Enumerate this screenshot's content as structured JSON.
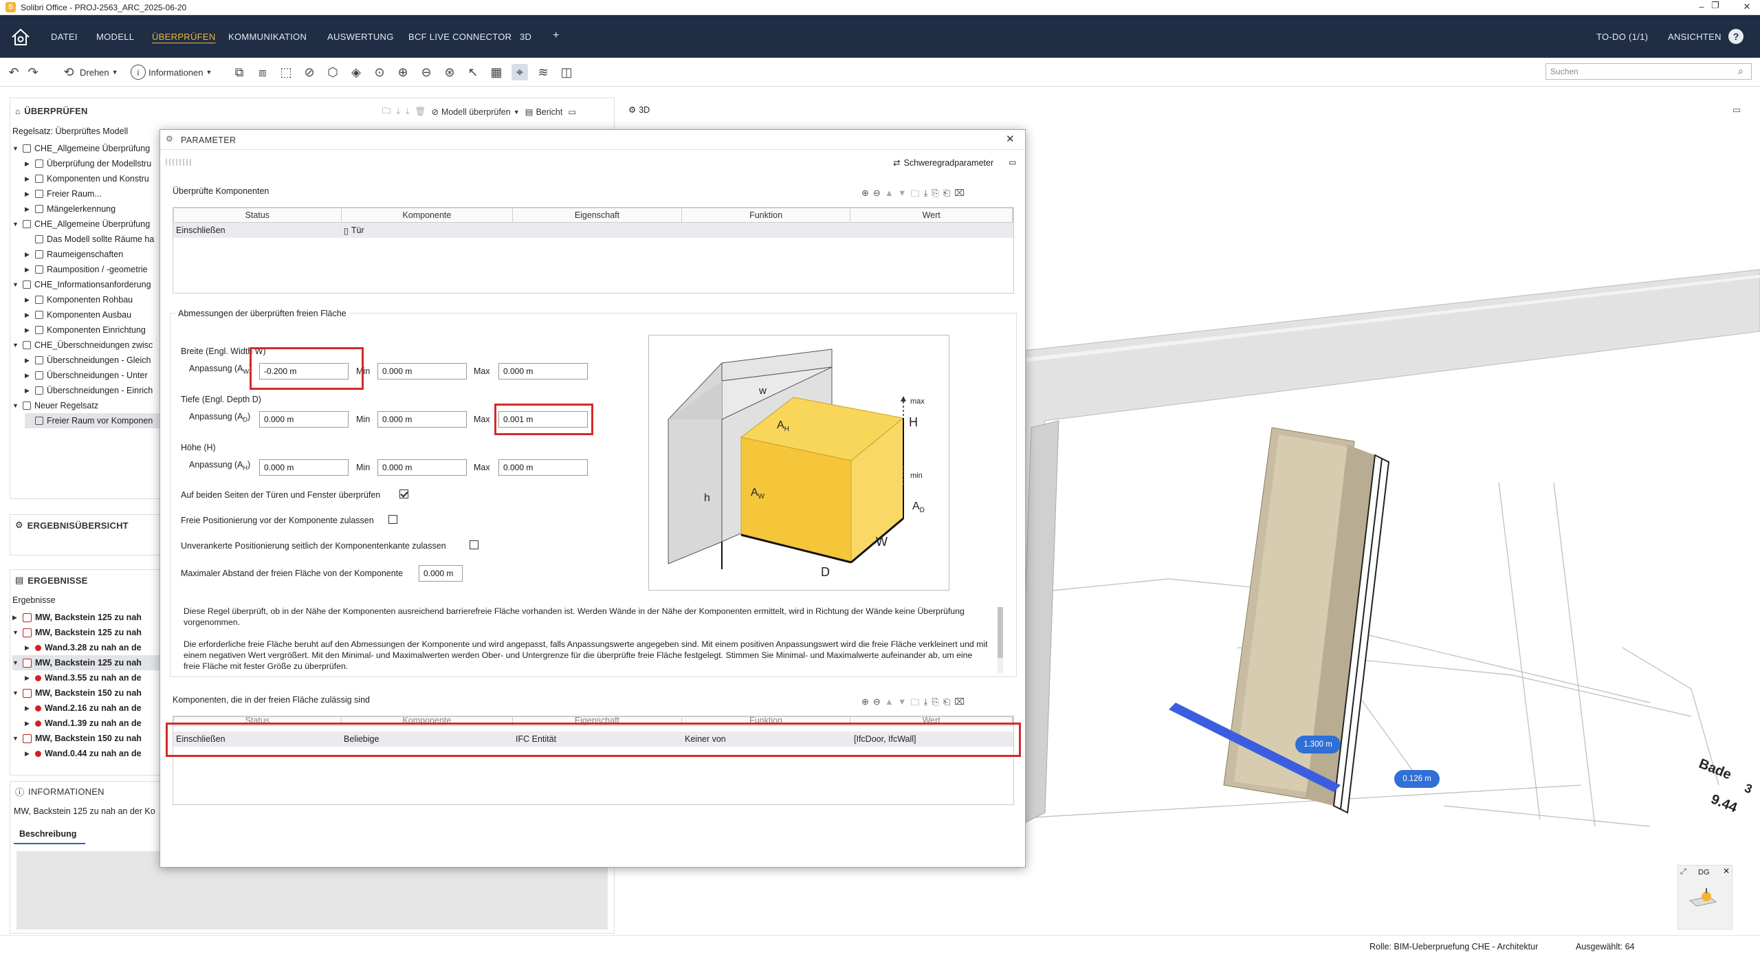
{
  "window": {
    "title": "Solibri Office - PROJ-2563_ARC_2025-06-20",
    "app_icon": "S"
  },
  "menu": {
    "items": [
      "DATEI",
      "MODELL",
      "ÜBERPRÜFEN",
      "KOMMUNIKATION",
      "AUSWERTUNG",
      "BCF LIVE CONNECTOR",
      "3D"
    ],
    "active": "ÜBERPRÜFEN",
    "add": "+",
    "todo": "TO-DO (1/1)",
    "views": "ANSICHTEN",
    "help": "?"
  },
  "toolbar": {
    "rotate": "Drehen",
    "info": "Informationen",
    "search_placeholder": "Suchen"
  },
  "left": {
    "check_header": "ÜBERPRÜFEN",
    "check_model_btn": "Modell überprüfen",
    "report_btn": "Bericht",
    "ruleset_label": "Regelsatz: Überprüftes Modell",
    "tree": [
      {
        "lvl": 0,
        "t": "CHE_Allgemeine Überprüfung",
        "tw": "▼"
      },
      {
        "lvl": 1,
        "t": "Überprüfung der Modellstru",
        "tw": "▶"
      },
      {
        "lvl": 1,
        "t": "Komponenten und Konstru",
        "tw": "▶"
      },
      {
        "lvl": 1,
        "t": "Freier Raum...",
        "tw": "▶"
      },
      {
        "lvl": 1,
        "t": "Mängelerkennung",
        "tw": "▶"
      },
      {
        "lvl": 0,
        "t": "CHE_Allgemeine Überprüfung",
        "tw": "▼"
      },
      {
        "lvl": 1,
        "t": "Das Modell sollte Räume ha",
        "tw": ""
      },
      {
        "lvl": 1,
        "t": "Raumeigenschaften",
        "tw": "▶"
      },
      {
        "lvl": 1,
        "t": "Raumposition / -geometrie",
        "tw": "▶"
      },
      {
        "lvl": 0,
        "t": "CHE_Informationsanforderung",
        "tw": "▼"
      },
      {
        "lvl": 1,
        "t": "Komponenten Rohbau",
        "tw": "▶"
      },
      {
        "lvl": 1,
        "t": "Komponenten Ausbau",
        "tw": "▶"
      },
      {
        "lvl": 1,
        "t": "Komponenten Einrichtung",
        "tw": "▶"
      },
      {
        "lvl": 0,
        "t": "CHE_Überschneidungen zwisc",
        "tw": "▼"
      },
      {
        "lvl": 1,
        "t": "Überschneidungen - Gleich",
        "tw": "▶"
      },
      {
        "lvl": 1,
        "t": "Überschneidungen - Unter",
        "tw": "▶"
      },
      {
        "lvl": 1,
        "t": "Überschneidungen - Einrich",
        "tw": "▶"
      },
      {
        "lvl": 0,
        "t": "Neuer Regelsatz",
        "tw": "▼"
      },
      {
        "lvl": 1,
        "t": "Freier Raum vor Komponen",
        "tw": "",
        "sel": true
      }
    ],
    "summary_header": "ERGEBNISÜBERSICHT",
    "results_header": "ERGEBNISSE",
    "results_label": "Ergebnisse",
    "results": [
      {
        "lvl": 0,
        "t": "MW, Backstein 125 zu nah",
        "tw": "▶"
      },
      {
        "lvl": 0,
        "t": "MW, Backstein 125 zu nah",
        "tw": "▼"
      },
      {
        "lvl": 1,
        "t": "Wand.3.28 zu nah an de",
        "tw": "▶"
      },
      {
        "lvl": 0,
        "t": "MW, Backstein 125 zu nah",
        "tw": "▼",
        "sel": true
      },
      {
        "lvl": 1,
        "t": "Wand.3.55 zu nah an de",
        "tw": "▶"
      },
      {
        "lvl": 0,
        "t": "MW, Backstein 150 zu nah",
        "tw": "▼"
      },
      {
        "lvl": 1,
        "t": "Wand.2.16 zu nah an de",
        "tw": "▶"
      },
      {
        "lvl": 1,
        "t": "Wand.1.39 zu nah an de",
        "tw": "▶"
      },
      {
        "lvl": 0,
        "t": "MW, Backstein 150 zu nah",
        "tw": "▼"
      },
      {
        "lvl": 1,
        "t": "Wand.0.44 zu nah an de",
        "tw": "▶"
      }
    ],
    "info_header": "INFORMATIONEN",
    "info_text": "MW, Backstein 125 zu nah an der Ko",
    "info_tab": "Beschreibung"
  },
  "dialog": {
    "title": "PARAMETER",
    "severity_btn": "Schweregradparameter",
    "checked_title": "Überprüfte Komponenten",
    "cols": [
      "Status",
      "Komponente",
      "Eigenschaft",
      "Funktion",
      "Wert"
    ],
    "checked_rows": [
      [
        "Einschließen",
        "Tür",
        "",
        "",
        ""
      ]
    ],
    "dims_title": "Abmessungen der überprüften freien Fläche",
    "width_label": "Breite (Engl. Width W)",
    "depth_label": "Tiefe (Engl. Depth D)",
    "height_label": "Höhe (H)",
    "adj_label": "Anpassung (A",
    "sub_w": "W",
    "sub_d": "D",
    "sub_h": "H",
    "min_label": "Min",
    "max_label": "Max",
    "width": {
      "adj": "-0.200 m",
      "min": "0.000 m",
      "max": "0.000 m"
    },
    "depth": {
      "adj": "0.000 m",
      "min": "0.000 m",
      "max": "0.001 m"
    },
    "height": {
      "adj": "0.000 m",
      "min": "0.000 m",
      "max": "0.000 m"
    },
    "opt1": "Auf beiden Seiten der Türen und Fenster überprüfen",
    "opt2": "Freie Positionierung vor der Komponente zulassen",
    "opt3": "Unverankerte Positionierung seitlich der Komponentenkante zulassen",
    "maxdist_label": "Maximaler Abstand der freien Fläche von der Komponente",
    "maxdist": "0.000 m",
    "desc1": "Diese Regel überprüft, ob in der Nähe der Komponenten ausreichend barrierefreie Fläche vorhanden ist. Werden Wände in der Nähe der Komponenten ermittelt, wird in Richtung der Wände keine Überprüfung vorgenommen.",
    "desc2": "Die erforderliche freie Fläche beruht auf den Abmessungen der Komponente und wird angepasst, falls Anpassungswerte angegeben sind. Mit einem positiven Anpassungswert wird die freie Fläche verkleinert und mit einem negativen Wert vergrößert. Mit den Minimal- und Maximalwerten werden Ober- und Untergrenze für die überprüfte freie Fläche festgelegt. Stimmen Sie Minimal- und Maximalwerte aufeinander ab, um eine freie Fläche mit fester Größe zu überprüfen.",
    "allowed_title": "Komponenten, die in der freien Fläche zulässig sind",
    "allowed_rows": [
      [
        "Einschließen",
        "Beliebige",
        "IFC Entität",
        "Keiner von",
        "[IfcDoor, IfcWall]"
      ]
    ],
    "diagram": {
      "w": "w",
      "h": "h",
      "AH": "A",
      "AW": "A",
      "AD": "A",
      "H": "H",
      "W": "W",
      "D": "D",
      "max": "max",
      "min": "min"
    }
  },
  "view3d": {
    "tab": "3D",
    "dim1": "1.300 m",
    "dim2": "0.126 m",
    "room_name": "Bade",
    "room_num": "3",
    "room_area": "9.44",
    "nav_label": "DG"
  },
  "status": {
    "role": "Rolle: BIM-Ueberpruefung CHE - Architektur",
    "selected": "Ausgewählt: 64"
  },
  "colors": {
    "menu_bg": "#1f2e45",
    "accent": "#f2b632",
    "highlight": "#d42a2a",
    "free_space": "#f5c53a",
    "dim_blue": "#2f6fd6"
  }
}
